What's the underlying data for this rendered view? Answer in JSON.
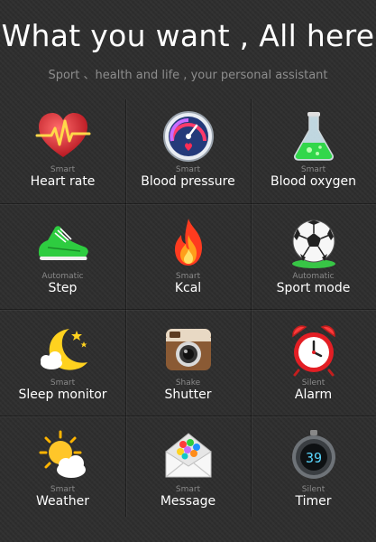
{
  "header": {
    "title": "What you want , All here",
    "subtitle": "Sport 、health and life , your personal assistant"
  },
  "features": [
    {
      "sub": "Smart",
      "name": "Heart rate",
      "icon": "heart-rate-icon"
    },
    {
      "sub": "Smart",
      "name": "Blood pressure",
      "icon": "blood-pressure-gauge-icon"
    },
    {
      "sub": "Smart",
      "name": "Blood oxygen",
      "icon": "flask-icon"
    },
    {
      "sub": "Automatic",
      "name": "Step",
      "icon": "sneaker-icon"
    },
    {
      "sub": "Smart",
      "name": "Kcal",
      "icon": "flame-icon"
    },
    {
      "sub": "Automatic",
      "name": "Sport mode",
      "icon": "soccer-ball-icon"
    },
    {
      "sub": "Smart",
      "name": "Sleep monitor",
      "icon": "moon-stars-icon"
    },
    {
      "sub": "Shake",
      "name": "Shutter",
      "icon": "camera-icon"
    },
    {
      "sub": "Silent",
      "name": "Alarm",
      "icon": "alarm-clock-icon"
    },
    {
      "sub": "Smart",
      "name": "Weather",
      "icon": "sun-cloud-icon"
    },
    {
      "sub": "Smart",
      "name": "Message",
      "icon": "envelope-icon"
    },
    {
      "sub": "Silent",
      "name": "Timer",
      "icon": "stopwatch-icon"
    }
  ],
  "timer_display": "39"
}
